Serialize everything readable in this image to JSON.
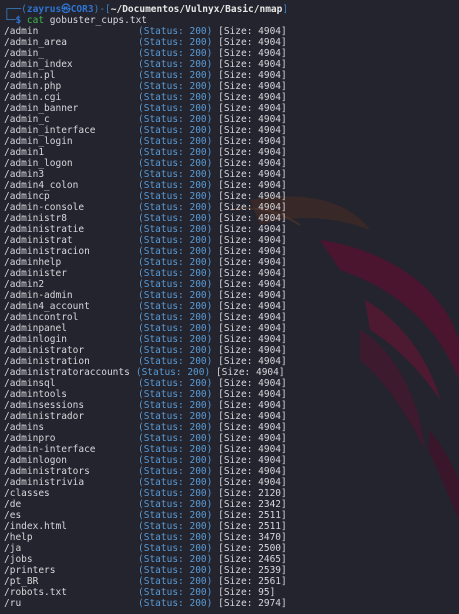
{
  "prompt": {
    "line1_open": "┌──(",
    "user": "zayrus㉿COR3",
    "line1_mid": ")-[",
    "cwd": "~/Documentos/Vulnyx/Basic/nmap",
    "line1_close": "]",
    "line2_prefix": "└─",
    "dollar": "$ ",
    "command": "cat",
    "argument": " gobuster_cups.txt"
  },
  "results": [
    {
      "path": "/admin",
      "status": "(Status: 200)",
      "size": "[Size: 4904]"
    },
    {
      "path": "/admin_area",
      "status": "(Status: 200)",
      "size": "[Size: 4904]"
    },
    {
      "path": "/admin_",
      "status": "(Status: 200)",
      "size": "[Size: 4904]"
    },
    {
      "path": "/admin_index",
      "status": "(Status: 200)",
      "size": "[Size: 4904]"
    },
    {
      "path": "/admin.pl",
      "status": "(Status: 200)",
      "size": "[Size: 4904]"
    },
    {
      "path": "/admin.php",
      "status": "(Status: 200)",
      "size": "[Size: 4904]"
    },
    {
      "path": "/admin.cgi",
      "status": "(Status: 200)",
      "size": "[Size: 4904]"
    },
    {
      "path": "/admin_banner",
      "status": "(Status: 200)",
      "size": "[Size: 4904]"
    },
    {
      "path": "/admin_c",
      "status": "(Status: 200)",
      "size": "[Size: 4904]"
    },
    {
      "path": "/admin_interface",
      "status": "(Status: 200)",
      "size": "[Size: 4904]"
    },
    {
      "path": "/admin_login",
      "status": "(Status: 200)",
      "size": "[Size: 4904]"
    },
    {
      "path": "/admin1",
      "status": "(Status: 200)",
      "size": "[Size: 4904]"
    },
    {
      "path": "/admin_logon",
      "status": "(Status: 200)",
      "size": "[Size: 4904]"
    },
    {
      "path": "/admin3",
      "status": "(Status: 200)",
      "size": "[Size: 4904]"
    },
    {
      "path": "/admin4_colon",
      "status": "(Status: 200)",
      "size": "[Size: 4904]"
    },
    {
      "path": "/admincp",
      "status": "(Status: 200)",
      "size": "[Size: 4904]"
    },
    {
      "path": "/admin-console",
      "status": "(Status: 200)",
      "size": "[Size: 4904]"
    },
    {
      "path": "/administr8",
      "status": "(Status: 200)",
      "size": "[Size: 4904]"
    },
    {
      "path": "/administratie",
      "status": "(Status: 200)",
      "size": "[Size: 4904]"
    },
    {
      "path": "/administrat",
      "status": "(Status: 200)",
      "size": "[Size: 4904]"
    },
    {
      "path": "/administracion",
      "status": "(Status: 200)",
      "size": "[Size: 4904]"
    },
    {
      "path": "/adminhelp",
      "status": "(Status: 200)",
      "size": "[Size: 4904]"
    },
    {
      "path": "/administer",
      "status": "(Status: 200)",
      "size": "[Size: 4904]"
    },
    {
      "path": "/admin2",
      "status": "(Status: 200)",
      "size": "[Size: 4904]"
    },
    {
      "path": "/admin-admin",
      "status": "(Status: 200)",
      "size": "[Size: 4904]"
    },
    {
      "path": "/admin4_account",
      "status": "(Status: 200)",
      "size": "[Size: 4904]"
    },
    {
      "path": "/admincontrol",
      "status": "(Status: 200)",
      "size": "[Size: 4904]"
    },
    {
      "path": "/adminpanel",
      "status": "(Status: 200)",
      "size": "[Size: 4904]"
    },
    {
      "path": "/adminlogin",
      "status": "(Status: 200)",
      "size": "[Size: 4904]"
    },
    {
      "path": "/administrator",
      "status": "(Status: 200)",
      "size": "[Size: 4904]"
    },
    {
      "path": "/administration",
      "status": "(Status: 200)",
      "size": "[Size: 4904]"
    },
    {
      "path": "/administratoraccounts",
      "status": "(Status: 200)",
      "size": "[Size: 4904]"
    },
    {
      "path": "/adminsql",
      "status": "(Status: 200)",
      "size": "[Size: 4904]"
    },
    {
      "path": "/admintools",
      "status": "(Status: 200)",
      "size": "[Size: 4904]"
    },
    {
      "path": "/adminsessions",
      "status": "(Status: 200)",
      "size": "[Size: 4904]"
    },
    {
      "path": "/administrador",
      "status": "(Status: 200)",
      "size": "[Size: 4904]"
    },
    {
      "path": "/admins",
      "status": "(Status: 200)",
      "size": "[Size: 4904]"
    },
    {
      "path": "/adminpro",
      "status": "(Status: 200)",
      "size": "[Size: 4904]"
    },
    {
      "path": "/admin-interface",
      "status": "(Status: 200)",
      "size": "[Size: 4904]"
    },
    {
      "path": "/adminlogon",
      "status": "(Status: 200)",
      "size": "[Size: 4904]"
    },
    {
      "path": "/administrators",
      "status": "(Status: 200)",
      "size": "[Size: 4904]"
    },
    {
      "path": "/administrivia",
      "status": "(Status: 200)",
      "size": "[Size: 4904]"
    },
    {
      "path": "/classes",
      "status": "(Status: 200)",
      "size": "[Size: 2120]"
    },
    {
      "path": "/de",
      "status": "(Status: 200)",
      "size": "[Size: 2342]"
    },
    {
      "path": "/es",
      "status": "(Status: 200)",
      "size": "[Size: 2511]"
    },
    {
      "path": "/index.html",
      "status": "(Status: 200)",
      "size": "[Size: 2511]"
    },
    {
      "path": "/help",
      "status": "(Status: 200)",
      "size": "[Size: 3470]"
    },
    {
      "path": "/ja",
      "status": "(Status: 200)",
      "size": "[Size: 2500]"
    },
    {
      "path": "/jobs",
      "status": "(Status: 200)",
      "size": "[Size: 2465]"
    },
    {
      "path": "/printers",
      "status": "(Status: 200)",
      "size": "[Size: 2539]"
    },
    {
      "path": "/pt_BR",
      "status": "(Status: 200)",
      "size": "[Size: 2561]"
    },
    {
      "path": "/robots.txt",
      "status": "(Status: 200)",
      "size": "[Size: 95]"
    },
    {
      "path": "/ru",
      "status": "(Status: 200)",
      "size": "[Size: 2974]"
    }
  ]
}
